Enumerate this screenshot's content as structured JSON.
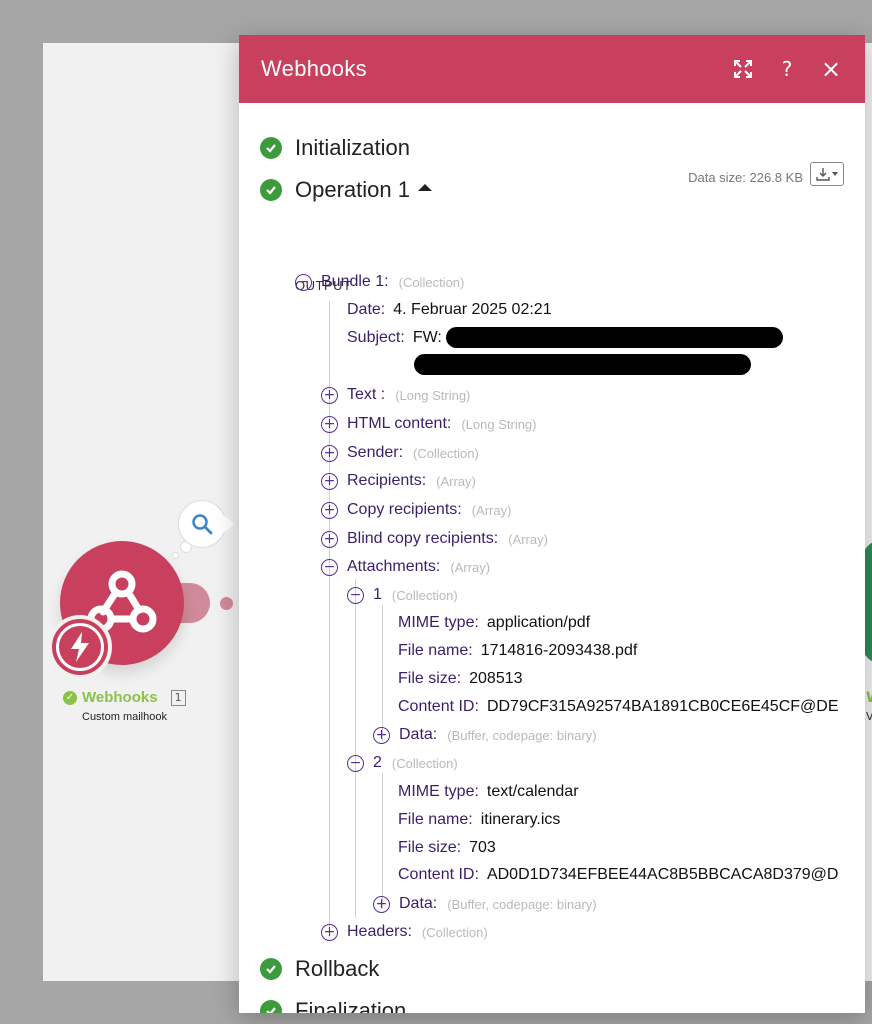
{
  "scenario": {
    "module_name": "Webhooks",
    "module_count": "1",
    "module_subtitle": "Custom mailhook",
    "next_module_label": "W",
    "next_module_sub": "V"
  },
  "modal": {
    "title": "Webhooks",
    "icons": [
      "expand-icon",
      "help-icon",
      "close-icon"
    ],
    "help_glyph": "?",
    "close_glyph": "×",
    "data_size": "Data size: 226.8 KB"
  },
  "phases": {
    "initialization": "Initialization",
    "operation": "Operation 1",
    "rollback": "Rollback",
    "finalization": "Finalization"
  },
  "output": {
    "label": "OUTPUT",
    "bundle": {
      "key": "Bundle 1:",
      "type": "(Collection)"
    },
    "date": {
      "key": "Date:",
      "value": "4. Februar 2025 02:21"
    },
    "subject": {
      "key": "Subject:",
      "value": "FW:"
    },
    "collapsed_fields": [
      {
        "key": "Text :",
        "type": "(Long String)"
      },
      {
        "key": "HTML content:",
        "type": "(Long String)"
      },
      {
        "key": "Sender:",
        "type": "(Collection)"
      },
      {
        "key": "Recipients:",
        "type": "(Array)"
      },
      {
        "key": "Copy recipients:",
        "type": "(Array)"
      },
      {
        "key": "Blind copy recipients:",
        "type": "(Array)"
      }
    ],
    "attachments": {
      "key": "Attachments:",
      "type": "(Array)"
    },
    "attachment_items": [
      {
        "index": "1",
        "type": "(Collection)",
        "mime_key": "MIME type:",
        "mime": "application/pdf",
        "fname_key": "File name:",
        "fname": "1714816-2093438.pdf",
        "fsize_key": "File size:",
        "fsize": "208513",
        "cid_key": "Content ID:",
        "cid": "DD79CF315A92574BA1891CB0CE6E45CF@DE",
        "data_key": "Data:",
        "data_type": "(Buffer, codepage: binary)"
      },
      {
        "index": "2",
        "type": "(Collection)",
        "mime_key": "MIME type:",
        "mime": "text/calendar",
        "fname_key": "File name:",
        "fname": "itinerary.ics",
        "fsize_key": "File size:",
        "fsize": "703",
        "cid_key": "Content ID:",
        "cid": "AD0D1D734EFBEE44AC8B5BBCACA8D379@D",
        "data_key": "Data:",
        "data_type": "(Buffer, codepage: binary)"
      }
    ],
    "headers": {
      "key": "Headers:",
      "type": "(Collection)"
    }
  },
  "colors": {
    "brand": "#c9405f",
    "success": "#3d9a3d",
    "tree_accent": "#5b2c9c"
  }
}
